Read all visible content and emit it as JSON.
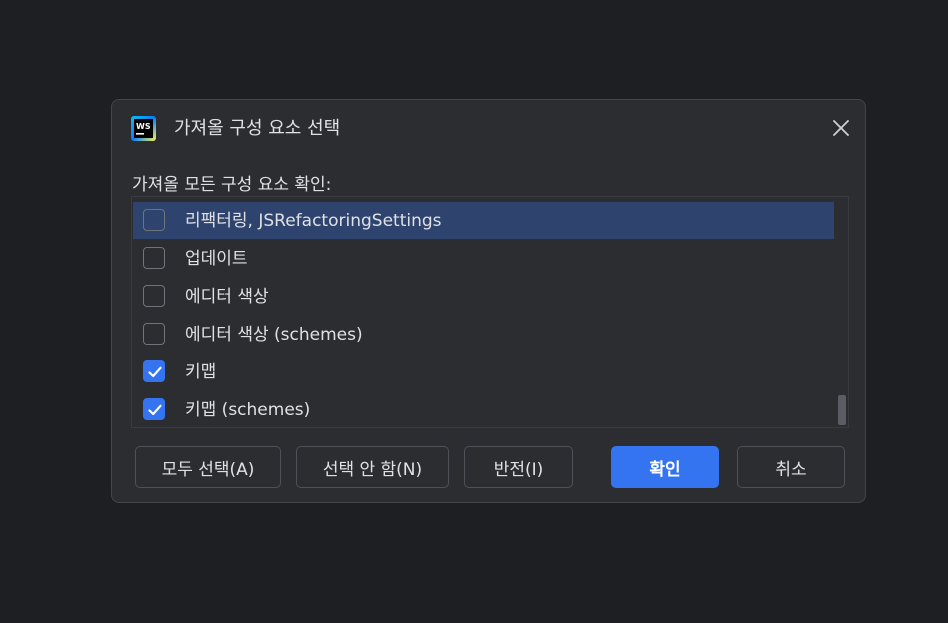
{
  "dialog": {
    "title": "가져올 구성 요소 선택",
    "icon": "webstorm-ws-icon",
    "prompt": "가져올 모든 구성 요소 확인:"
  },
  "components": [
    {
      "label": "리팩터링, JSRefactoringSettings",
      "checked": false,
      "selected": true
    },
    {
      "label": "업데이트",
      "checked": false,
      "selected": false
    },
    {
      "label": "에디터 색상",
      "checked": false,
      "selected": false
    },
    {
      "label": "에디터 색상 (schemes)",
      "checked": false,
      "selected": false
    },
    {
      "label": "키맵",
      "checked": true,
      "selected": false
    },
    {
      "label": "키맵 (schemes)",
      "checked": true,
      "selected": false
    }
  ],
  "buttons": {
    "select_all": "모두 선택(A)",
    "select_none": "선택 안 함(N)",
    "invert": "반전(I)",
    "ok": "확인",
    "cancel": "취소"
  },
  "colors": {
    "accent": "#3574f0",
    "selected_row": "#2e436e",
    "dialog_bg": "#2b2d30",
    "page_bg": "#1e1f22"
  }
}
